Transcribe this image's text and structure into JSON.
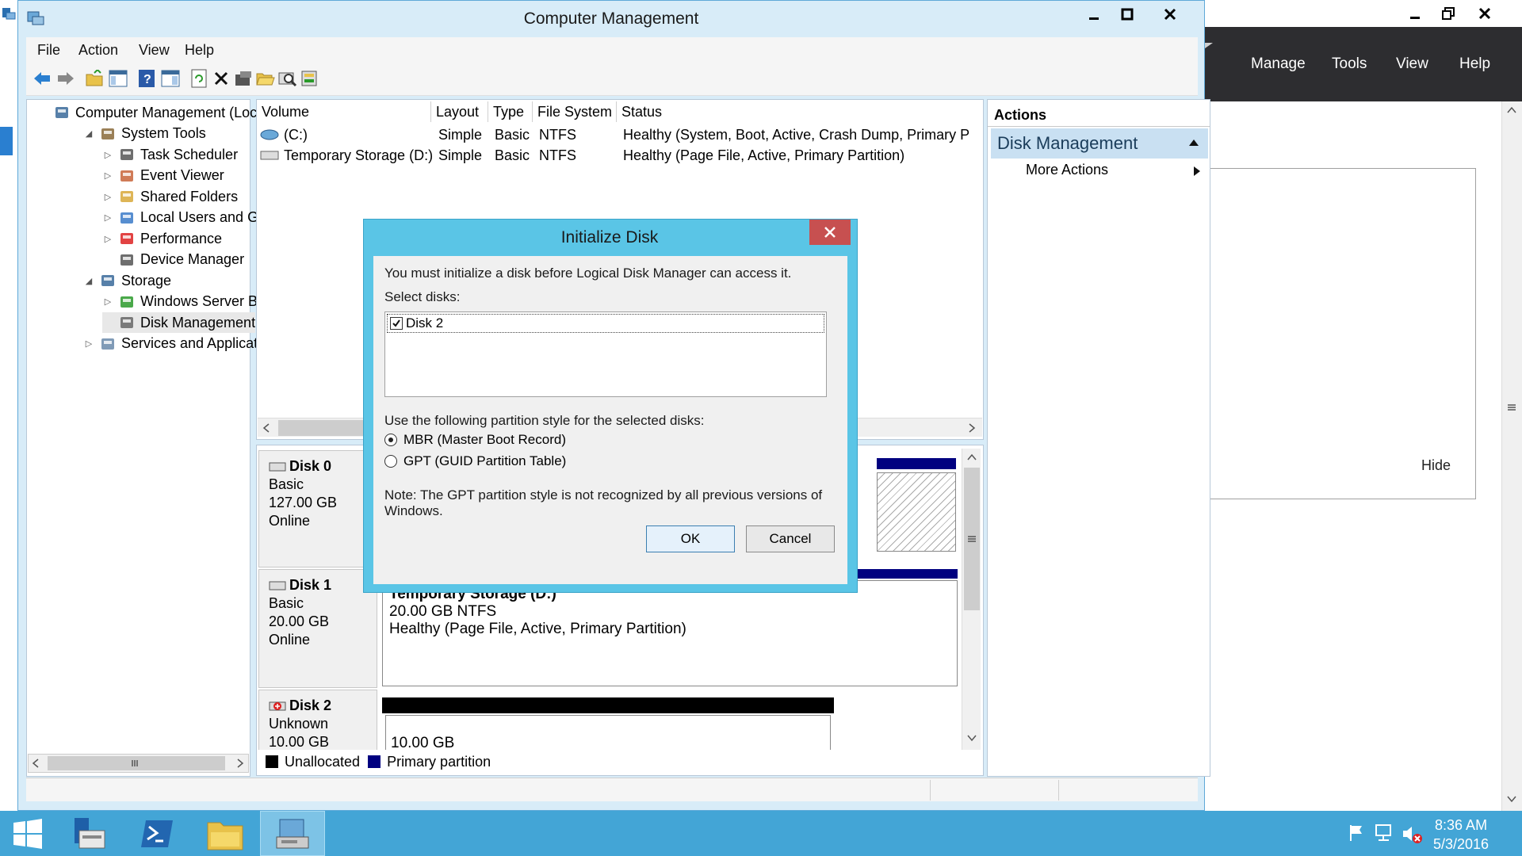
{
  "server_manager": {
    "menu": [
      "Manage",
      "Tools",
      "View",
      "Help"
    ],
    "hide_label": "Hide"
  },
  "window": {
    "title": "Computer Management",
    "menu": [
      "File",
      "Action",
      "View",
      "Help"
    ]
  },
  "tree": {
    "items": [
      {
        "label": "Computer Management (Local",
        "level": 0,
        "expander": "",
        "icon": "computer-management-icon"
      },
      {
        "label": "System Tools",
        "level": 1,
        "expander": "◢",
        "icon": "tools-icon"
      },
      {
        "label": "Task Scheduler",
        "level": 2,
        "expander": "▷",
        "icon": "clock-icon"
      },
      {
        "label": "Event Viewer",
        "level": 2,
        "expander": "▷",
        "icon": "event-viewer-icon"
      },
      {
        "label": "Shared Folders",
        "level": 2,
        "expander": "▷",
        "icon": "shared-folder-icon"
      },
      {
        "label": "Local Users and Groups",
        "level": 2,
        "expander": "▷",
        "icon": "users-icon"
      },
      {
        "label": "Performance",
        "level": 2,
        "expander": "▷",
        "icon": "performance-icon"
      },
      {
        "label": "Device Manager",
        "level": 2,
        "expander": "",
        "icon": "device-manager-icon"
      },
      {
        "label": "Storage",
        "level": 1,
        "expander": "◢",
        "icon": "storage-icon"
      },
      {
        "label": "Windows Server Backup",
        "level": 2,
        "expander": "▷",
        "icon": "backup-icon"
      },
      {
        "label": "Disk Management",
        "level": 2,
        "expander": "",
        "icon": "disk-management-icon"
      },
      {
        "label": "Services and Applications",
        "level": 1,
        "expander": "▷",
        "icon": "services-icon"
      }
    ]
  },
  "volumes": {
    "columns": [
      "Volume",
      "Layout",
      "Type",
      "File System",
      "Status"
    ],
    "rows": [
      {
        "volume": "(C:)",
        "layout": "Simple",
        "type": "Basic",
        "fs": "NTFS",
        "status": "Healthy (System, Boot, Active, Crash Dump, Primary P"
      },
      {
        "volume": "Temporary Storage (D:)",
        "layout": "Simple",
        "type": "Basic",
        "fs": "NTFS",
        "status": "Healthy (Page File, Active, Primary Partition)"
      }
    ]
  },
  "disks": [
    {
      "name": "Disk 0",
      "type": "Basic",
      "size": "127.00 GB",
      "state": "Online"
    },
    {
      "name": "Disk 1",
      "type": "Basic",
      "size": "20.00 GB",
      "state": "Online",
      "partition": {
        "title": "Temporary Storage  (D:)",
        "size": "20.00 GB NTFS",
        "status": "Healthy (Page File, Active, Primary Partition)"
      }
    },
    {
      "name": "Disk 2",
      "type": "Unknown",
      "size": "10.00 GB",
      "unallocated_size": "10.00 GB"
    }
  ],
  "legend": {
    "unallocated": "Unallocated",
    "primary": "Primary partition"
  },
  "actions": {
    "title": "Actions",
    "section": "Disk Management",
    "more": "More Actions"
  },
  "dialog": {
    "title": "Initialize Disk",
    "message": "You must initialize a disk before Logical Disk Manager can access it.",
    "select_label": "Select disks:",
    "disk_item": "Disk 2",
    "partition_label": "Use the following partition style for the selected disks:",
    "mbr": "MBR (Master Boot Record)",
    "gpt": "GPT (GUID Partition Table)",
    "note_line1": "Note: The GPT partition style is not recognized by all previous versions of",
    "note_line2": "Windows.",
    "ok": "OK",
    "cancel": "Cancel"
  },
  "taskbar": {
    "time": "8:36 AM",
    "date": "5/3/2016"
  },
  "colors": {
    "accent": "#5ac5e6",
    "primary_partition": "#000080",
    "unallocated": "#000000",
    "taskbar": "#43a5d6"
  }
}
